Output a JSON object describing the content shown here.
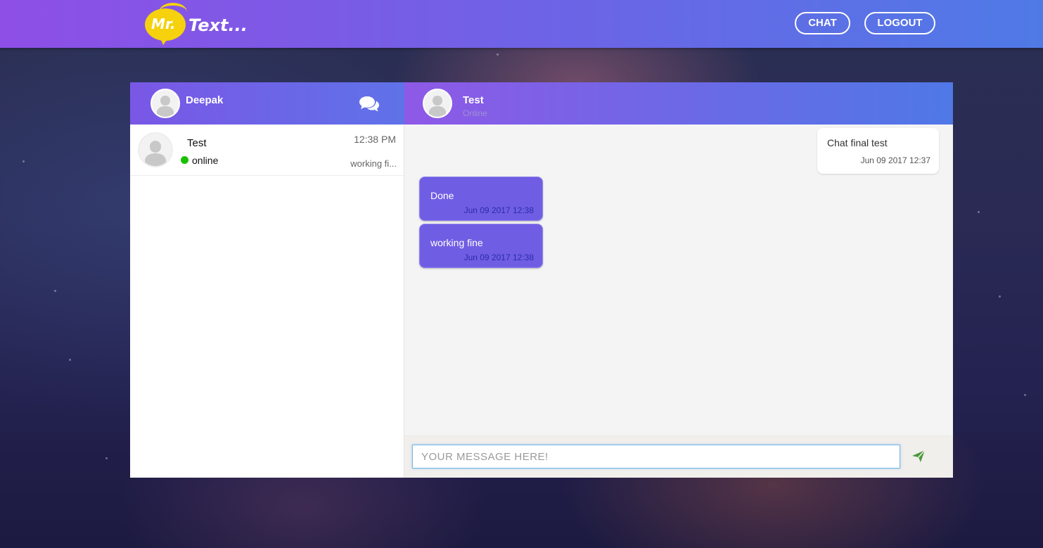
{
  "app": {
    "logo_mr": "Mr.",
    "logo_text": "Text...",
    "nav": {
      "chat_label": "CHAT",
      "logout_label": "LOGOUT"
    }
  },
  "sidebar": {
    "user_name": "Deepak",
    "contacts": [
      {
        "name": "Test",
        "status": "online",
        "time": "12:38 PM",
        "last_message": "working fi..."
      }
    ]
  },
  "conversation": {
    "peer_name": "Test",
    "peer_status": "Online",
    "messages": [
      {
        "direction": "sent",
        "text": "Chat final test",
        "time": "Jun 09 2017 12:37"
      },
      {
        "direction": "received",
        "text": "Done",
        "time": "Jun 09 2017 12:38"
      },
      {
        "direction": "received",
        "text": "working fine",
        "time": "Jun 09 2017 12:38"
      }
    ],
    "composer": {
      "placeholder": "YOUR MESSAGE HERE!",
      "value": ""
    }
  },
  "colors": {
    "header_gradient_start": "#8e4fe6",
    "header_gradient_end": "#4f7ae6",
    "received_bubble": "#6f5ee4",
    "online_dot": "#18c000",
    "send_icon": "#4a9a3a",
    "logo_yellow": "#f5d10e"
  },
  "icons": {
    "chats": "chat-bubbles-icon",
    "send": "send-icon",
    "avatar": "user-avatar-icon"
  }
}
